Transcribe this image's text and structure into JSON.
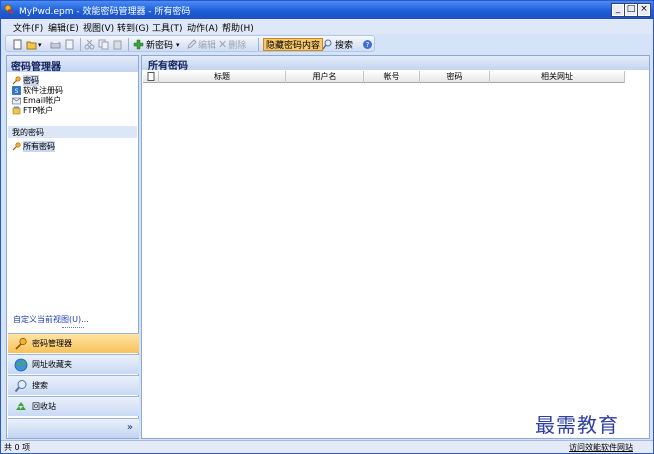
{
  "window": {
    "title": "MyPwd.epm - 效能密码管理器 - 所有密码",
    "min_symbol": "_",
    "max_symbol": "□",
    "close_symbol": "×"
  },
  "menu": [
    "文件(F)",
    "编辑(E)",
    "视图(V)",
    "转到(G)",
    "工具(T)",
    "动作(A)",
    "帮助(H)"
  ],
  "toolbar": {
    "new_password": "新密码",
    "edit": "编辑",
    "delete": "删除",
    "hide_content": "隐藏密码内容",
    "search": "搜索"
  },
  "left_pane": {
    "header": "密码管理器",
    "categories": [
      "密码",
      "软件注册码",
      "Email帐户",
      "FTP帐户"
    ],
    "my_passwords_label": "我的密码",
    "all_passwords": "所有密码",
    "customize_view": "自定义当前视图(U)..."
  },
  "nav_buttons": [
    "密码管理器",
    "网址收藏夹",
    "搜索",
    "回收站"
  ],
  "nav_more": "»",
  "right_pane": {
    "header": "所有密码",
    "columns": [
      "标题",
      "用户名",
      "帐号",
      "密码",
      "相关网址"
    ]
  },
  "watermark": "最需教育",
  "status": {
    "count": "共 0 项",
    "link": "访问效能软件网站"
  }
}
